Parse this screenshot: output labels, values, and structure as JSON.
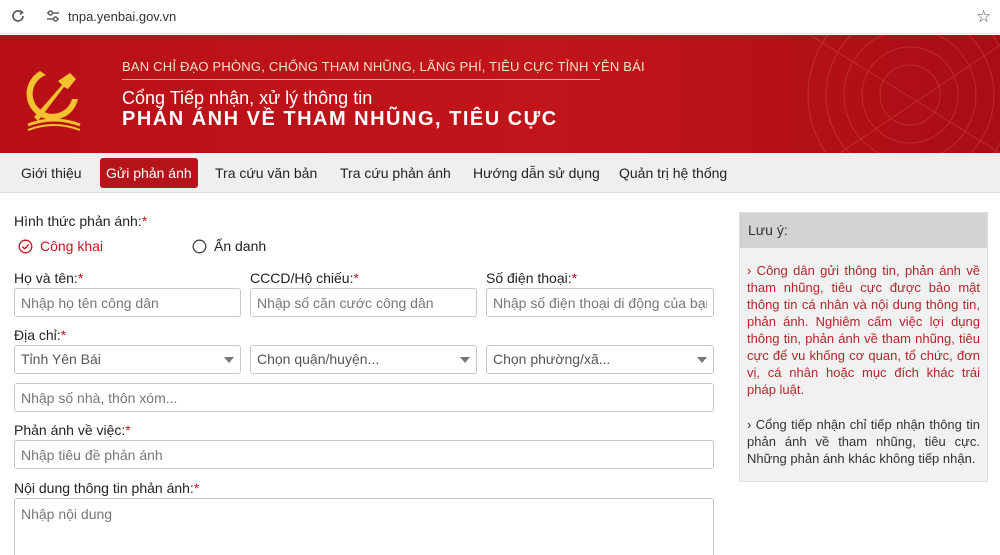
{
  "browser": {
    "url": "tnpa.yenbai.gov.vn"
  },
  "banner": {
    "gov_name": "BAN CHỈ ĐẠO PHÒNG, CHỐNG THAM NHŨNG, LÃNG PHÍ, TIÊU CỰC TỈNH YÊN BÁI",
    "portal_title": "Cổng Tiếp nhận, xử lý thông tin",
    "portal_subtitle": "PHẢN ÁNH VỀ THAM NHŨNG, TIÊU CỰC"
  },
  "nav": {
    "tabs": [
      {
        "label": "Giới thiệu",
        "active": false
      },
      {
        "label": "Gửi phản ánh",
        "active": true
      },
      {
        "label": "Tra cứu văn bản",
        "active": false
      },
      {
        "label": "Tra cứu phản ánh",
        "active": false
      },
      {
        "label": "Hướng dẫn sử dụng",
        "active": false
      },
      {
        "label": "Quản trị hệ thống",
        "active": false
      }
    ]
  },
  "form": {
    "required_mark": "*",
    "report_type": {
      "label": "Hình thức phản ánh:",
      "options": [
        {
          "label": "Công khai",
          "checked": true
        },
        {
          "label": "Ẩn danh",
          "checked": false
        }
      ]
    },
    "full_name": {
      "label": "Họ và tên:",
      "placeholder": "Nhập họ tên công dân"
    },
    "id_number": {
      "label": "CCCD/Hộ chiếu:",
      "placeholder": "Nhập số căn cước công dân"
    },
    "phone": {
      "label": "Số điện thoại:",
      "placeholder": "Nhập số điện thoại di động của bạn"
    },
    "address": {
      "label": "Địa chỉ:",
      "province": "Tỉnh Yên Bái",
      "district": "Chọn quận/huyện...",
      "ward": "Chọn phường/xã...",
      "street_placeholder": "Nhập số nhà, thôn xóm..."
    },
    "subject": {
      "label": "Phản ánh về việc:",
      "placeholder": "Nhập tiêu đề phản ánh"
    },
    "content": {
      "label": "Nội dung thông tin phản ánh:",
      "placeholder": "Nhập nội dung"
    }
  },
  "notice": {
    "title": "Lưu ý:",
    "items": [
      "› Công dân gửi thông tin, phản ánh về tham nhũng, tiêu cực được bảo mật thông tin cá nhân và nội dung thông tin, phản ánh. Nghiêm cấm việc lợi dụng thông tin, phản ánh về tham nhũng, tiêu cực để vu khống cơ quan, tổ chức, đơn vị, cá nhân hoặc mục đích khác trái pháp luật.",
      "› Cổng tiếp nhận chỉ tiếp nhận thông tin phản ánh về tham nhũng, tiêu cực. Những phản ánh khác không tiếp nhận."
    ]
  },
  "colors": {
    "brand_red": "#b5141b",
    "emblem_gold": "#f2c230",
    "required_red": "#c8141c"
  }
}
